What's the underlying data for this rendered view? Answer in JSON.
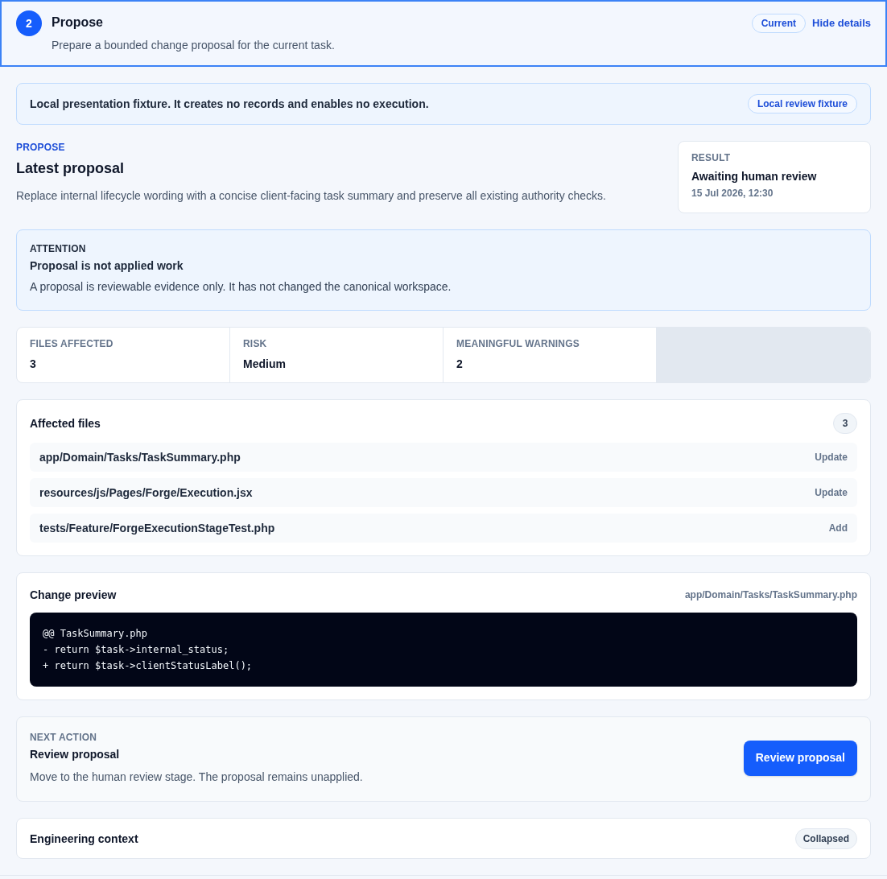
{
  "stage": {
    "number": "2",
    "title": "Propose",
    "description": "Prepare a bounded change proposal for the current task.",
    "selected": true,
    "status_badge": "Current",
    "toggle_link": "Hide details"
  },
  "notice": {
    "text": "Local presentation fixture. It creates no records and enables no execution.",
    "badge": "Local review fixture"
  },
  "proposal": {
    "eyebrow": "PROPOSE",
    "title": "Latest proposal",
    "summary": "Replace internal lifecycle wording with a concise client-facing task summary and preserve all existing authority checks.",
    "result": {
      "label": "RESULT",
      "value": "Awaiting human review",
      "timestamp": "15 Jul 2026, 12:30"
    }
  },
  "attention": {
    "label": "ATTENTION",
    "title": "Proposal is not applied work",
    "text": "A proposal is reviewable evidence only. It has not changed the canonical workspace."
  },
  "stats": [
    {
      "label": "FILES AFFECTED",
      "value": "3"
    },
    {
      "label": "RISK",
      "value": "Medium"
    },
    {
      "label": "MEANINGFUL WARNINGS",
      "value": "2"
    }
  ],
  "affected_files": {
    "title": "Affected files",
    "count": "3",
    "files": [
      {
        "path": "app/Domain/Tasks/TaskSummary.php",
        "action": "Update"
      },
      {
        "path": "resources/js/Pages/Forge/Execution.jsx",
        "action": "Update"
      },
      {
        "path": "tests/Feature/ForgeExecutionStageTest.php",
        "action": "Add"
      }
    ]
  },
  "change_preview": {
    "title": "Change preview",
    "file": "app/Domain/Tasks/TaskSummary.php",
    "lines": [
      "@@ TaskSummary.php",
      "- return $task->internal_status;",
      "+ return $task->clientStatusLabel();"
    ]
  },
  "next_action": {
    "label": "NEXT ACTION",
    "title": "Review proposal",
    "text": "Move to the human review stage. The proposal remains unapplied.",
    "button": "Review proposal"
  },
  "engineering_context": {
    "title": "Engineering context",
    "state": "Collapsed"
  }
}
